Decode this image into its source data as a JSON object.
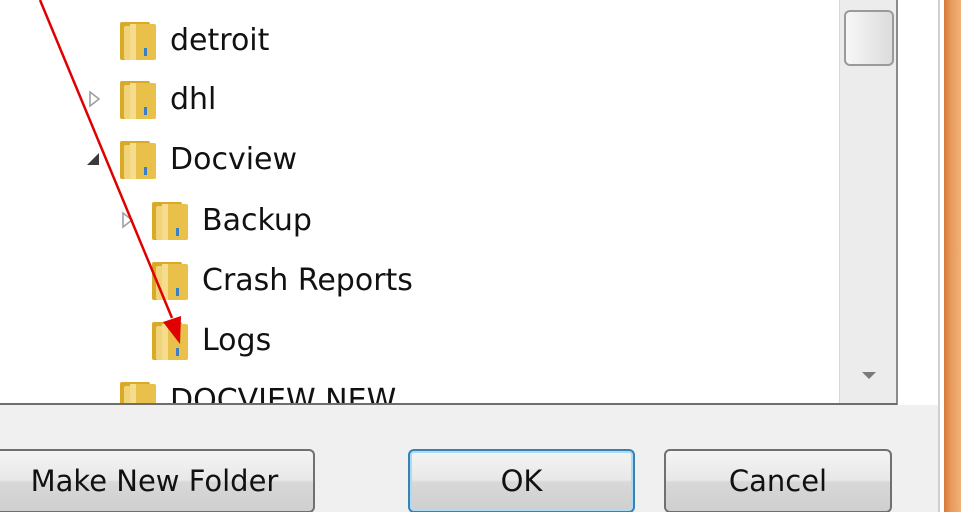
{
  "tree": {
    "items": [
      {
        "label": "detroit",
        "expander": "none"
      },
      {
        "label": "dhl",
        "expander": "collapsed"
      },
      {
        "label": "Docview",
        "expander": "expanded"
      },
      {
        "label": "Backup",
        "expander": "collapsed"
      },
      {
        "label": "Crash Reports",
        "expander": "none"
      },
      {
        "label": "Logs",
        "expander": "none"
      },
      {
        "label": "DOCVIEW NEW",
        "expander": "none"
      }
    ]
  },
  "buttons": {
    "make_new_folder": "Make New Folder",
    "ok": "OK",
    "cancel": "Cancel"
  },
  "colors": {
    "folder": "#e8c04a",
    "annotation_arrow": "#e00000",
    "ok_border": "#3c7fb1",
    "window_edge": "#e69a5c"
  }
}
